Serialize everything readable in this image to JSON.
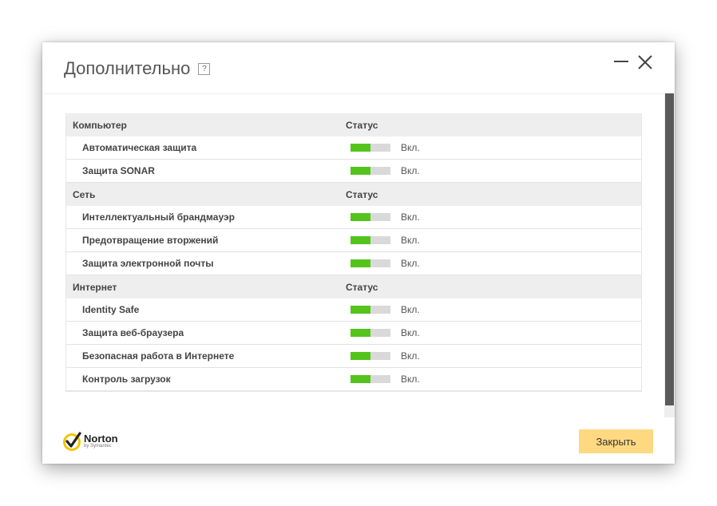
{
  "window": {
    "title": "Дополнительно",
    "help_label": "?"
  },
  "colors": {
    "bar_on": "#54c31c",
    "bar_track": "#d9d9d9",
    "close_button": "#ffd982",
    "category_bg": "#eeeeee"
  },
  "categories": [
    {
      "name": "Компьютер",
      "status_label": "Статус",
      "items": [
        {
          "label": "Автоматическая защита",
          "state": "Вкл.",
          "level": 0.5
        },
        {
          "label": "Защита SONAR",
          "state": "Вкл.",
          "level": 0.5
        }
      ]
    },
    {
      "name": "Сеть",
      "status_label": "Статус",
      "items": [
        {
          "label": "Интеллектуальный брандмауэр",
          "state": "Вкл.",
          "level": 0.5
        },
        {
          "label": "Предотвращение вторжений",
          "state": "Вкл.",
          "level": 0.5
        },
        {
          "label": "Защита электронной почты",
          "state": "Вкл.",
          "level": 0.5
        }
      ]
    },
    {
      "name": "Интернет",
      "status_label": "Статус",
      "items": [
        {
          "label": "Identity Safe",
          "state": "Вкл.",
          "level": 0.5
        },
        {
          "label": "Защита веб-браузера",
          "state": "Вкл.",
          "level": 0.5
        },
        {
          "label": "Безопасная работа в Интернете",
          "state": "Вкл.",
          "level": 0.5
        },
        {
          "label": "Контроль загрузок",
          "state": "Вкл.",
          "level": 0.5
        }
      ]
    }
  ],
  "footer": {
    "logo_brand": "Norton",
    "logo_sub": "by Symantec",
    "close_label": "Закрыть"
  },
  "icons": {
    "minimize": "minimize-icon",
    "close": "close-icon",
    "help": "help-icon",
    "logo": "norton-checkmark-icon"
  }
}
